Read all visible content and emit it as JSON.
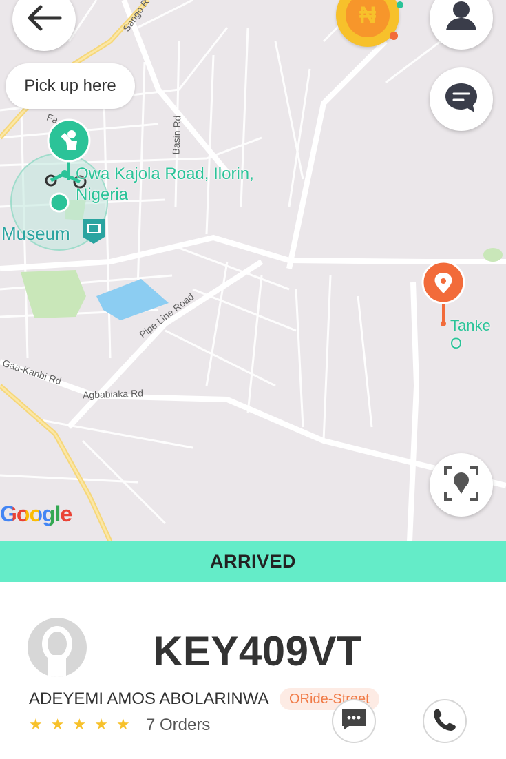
{
  "map": {
    "pickup_label": "Pick up here",
    "pickup_place": "Owa Kajola Road, Ilorin, Nigeria",
    "museum_label": "Museum",
    "destination_label": "Tanke O",
    "roads": {
      "sango": "Sango R",
      "basin": "Basin Rd",
      "pipeline": "Pipe Line Road",
      "gaa_kanbi": "Gaa-Kanbi Rd",
      "agbabiaka": "Agbabiaka Rd",
      "fa": "Fa"
    },
    "attribution": "Google"
  },
  "controls": {
    "back_icon": "arrow-left-icon",
    "wallet_icon": "naira-coin-icon",
    "profile_icon": "user-icon",
    "chat_icon": "chat-bubble-icon",
    "recenter_icon": "locate-icon",
    "wallet_symbol": "₦"
  },
  "status": {
    "label": "ARRIVED"
  },
  "driver": {
    "plate": "KEY409VT",
    "name": "ADEYEMI AMOS ABOLARINWA",
    "service": "ORide-Street",
    "rating": 5,
    "orders": "7 Orders",
    "message_icon": "message-icon",
    "call_icon": "phone-icon"
  },
  "colors": {
    "accent": "#64ecc8",
    "pickup_green": "#2bc398",
    "destination_orange": "#f26b3a",
    "badge_text": "#f07a46",
    "star": "#f7c12b"
  }
}
